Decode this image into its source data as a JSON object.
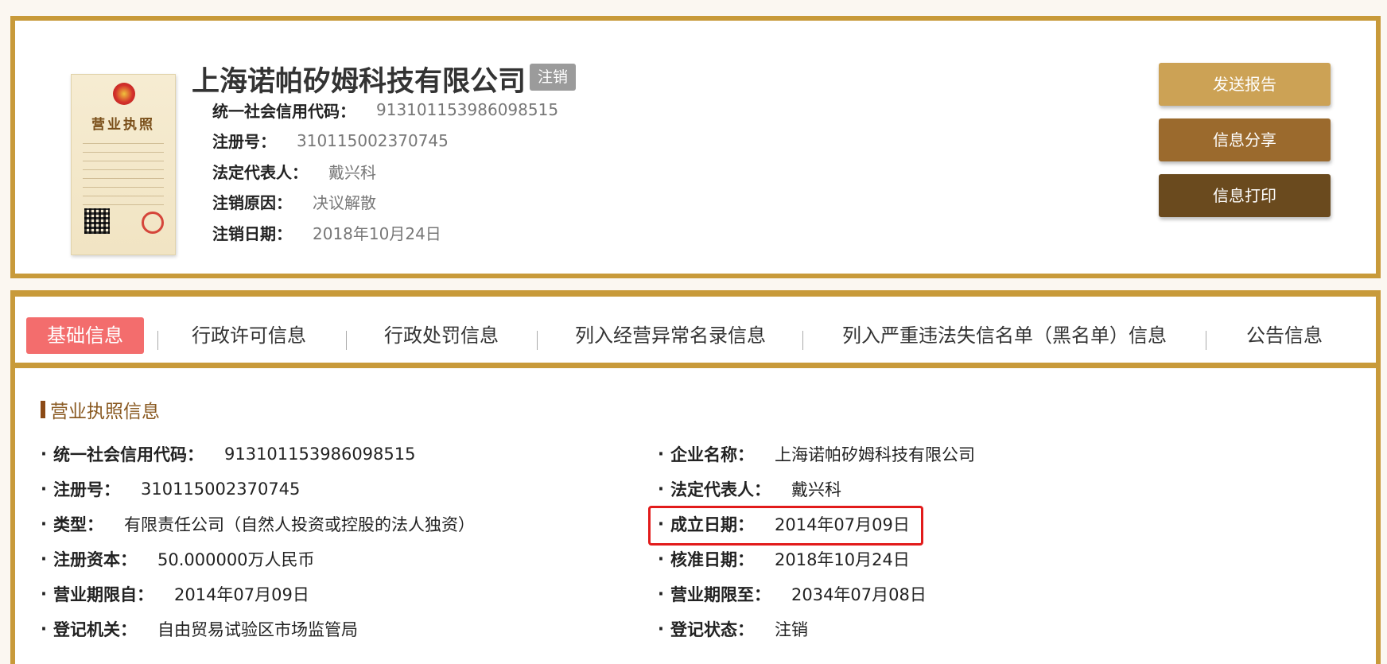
{
  "header": {
    "company_name": "上海诺帕矽姆科技有限公司",
    "status_badge": "注销",
    "info": [
      {
        "label": "统一社会信用代码：",
        "value": "913101153986098515"
      },
      {
        "label": "注册号：",
        "value": "310115002370745"
      },
      {
        "label": "法定代表人：",
        "value": "戴兴科"
      },
      {
        "label": "注销原因：",
        "value": "决议解散"
      },
      {
        "label": "注销日期：",
        "value": "2018年10月24日"
      }
    ],
    "license_image": {
      "title": "营业执照",
      "icon": "business-license-image"
    }
  },
  "actions": {
    "send_report": "发送报告",
    "share": "信息分享",
    "print": "信息打印"
  },
  "tabs": [
    {
      "label": "基础信息",
      "active": true
    },
    {
      "label": "行政许可信息",
      "active": false
    },
    {
      "label": "行政处罚信息",
      "active": false
    },
    {
      "label": "列入经营异常名录信息",
      "active": false
    },
    {
      "label": "列入严重违法失信名单（黑名单）信息",
      "active": false
    },
    {
      "label": "公告信息",
      "active": false
    }
  ],
  "section": {
    "title": "营业执照信息",
    "left_fields": [
      {
        "label": "统一社会信用代码：",
        "value": "913101153986098515"
      },
      {
        "label": "注册号：",
        "value": "310115002370745"
      },
      {
        "label": "类型：",
        "value": "有限责任公司（自然人投资或控股的法人独资）"
      },
      {
        "label": "注册资本：",
        "value": "50.000000万人民币"
      },
      {
        "label": "营业期限自：",
        "value": "2014年07月09日"
      },
      {
        "label": "登记机关：",
        "value": "自由贸易试验区市场监管局"
      }
    ],
    "right_fields": [
      {
        "label": "企业名称：",
        "value": "上海诺帕矽姆科技有限公司"
      },
      {
        "label": "法定代表人：",
        "value": "戴兴科"
      },
      {
        "label": "成立日期：",
        "value": "2014年07月09日",
        "highlighted": true
      },
      {
        "label": "核准日期：",
        "value": "2018年10月24日"
      },
      {
        "label": "营业期限至：",
        "value": "2034年07月08日"
      },
      {
        "label": "登记状态：",
        "value": "注销"
      }
    ]
  },
  "colors": {
    "gold_border": "#c89a3a",
    "active_tab": "#f36d6d",
    "btn_report": "#cca255",
    "btn_share": "#9b6a2d",
    "btn_print": "#6a4a1e",
    "badge_gray": "#9b9b9b",
    "highlight_red": "#e21b1b"
  }
}
